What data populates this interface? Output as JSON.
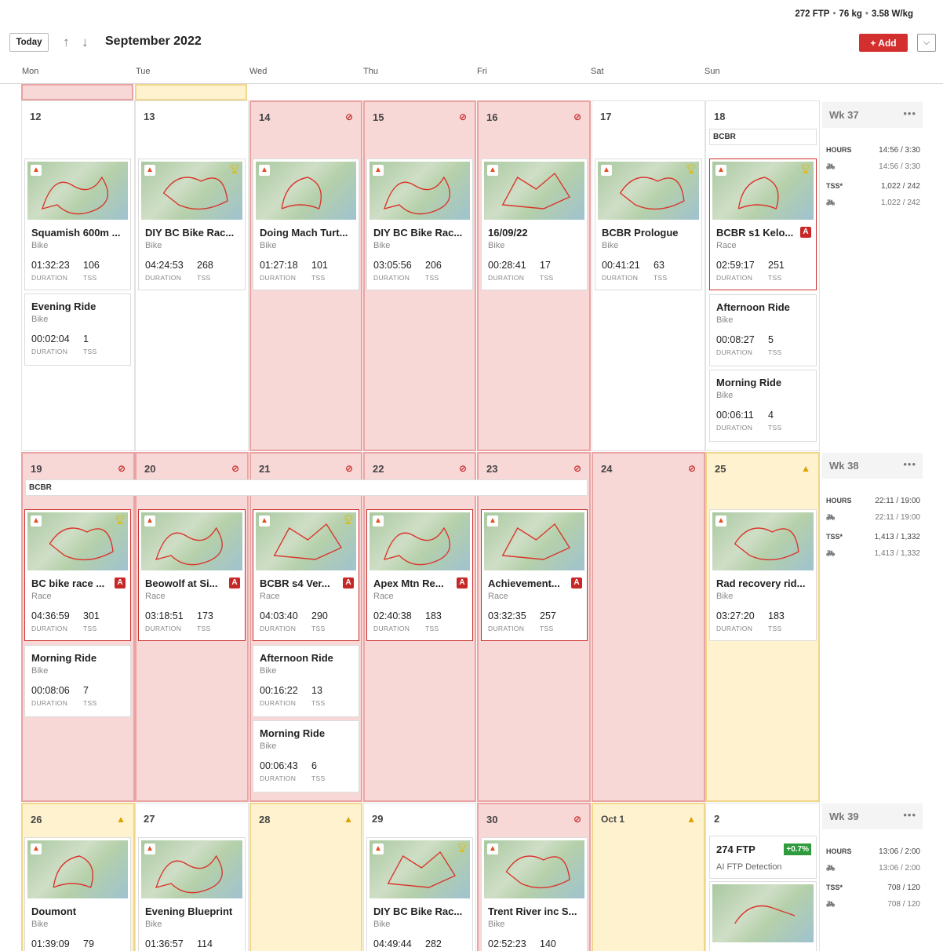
{
  "header": {
    "ftp": "272 FTP",
    "weight": "76 kg",
    "wkg": "3.58 W/kg",
    "today": "Today",
    "month": "September 2022",
    "add": "+ Add"
  },
  "days": [
    "Mon",
    "Tue",
    "Wed",
    "Thu",
    "Fri",
    "Sat",
    "Sun"
  ],
  "week37": {
    "wk": "Wk 37",
    "hours_label": "HOURS",
    "hours": "14:56 / 3:30",
    "hours_bike": "14:56 / 3:30",
    "tss_label": "TSS*",
    "tss": "1,022 / 242",
    "tss_bike": "1,022 / 242"
  },
  "week38": {
    "wk": "Wk 38",
    "hours_label": "HOURS",
    "hours": "22:11 / 19:00",
    "hours_bike": "22:11 / 19:00",
    "tss_label": "TSS*",
    "tss": "1,413 / 1,332",
    "tss_bike": "1,413 / 1,332"
  },
  "week39": {
    "wk": "Wk 39",
    "hours_label": "HOURS",
    "hours": "13:06 / 2:00",
    "hours_bike": "13:06 / 2:00",
    "tss_label": "TSS*",
    "tss": "708 / 120",
    "tss_bike": "708 / 120"
  },
  "labels": {
    "duration": "DURATION",
    "tss": "TSS",
    "race": "Race",
    "bike": "Bike",
    "bcbr": "BCBR",
    "a": "A"
  },
  "ftp_card": {
    "value": "274 FTP",
    "delta": "+0.7%",
    "sub": "AI FTP Detection"
  },
  "daynums": {
    "d12": "12",
    "d13": "13",
    "d14": "14",
    "d15": "15",
    "d16": "16",
    "d17": "17",
    "d18": "18",
    "d19": "19",
    "d20": "20",
    "d21": "21",
    "d22": "22",
    "d23": "23",
    "d24": "24",
    "d25": "25",
    "d26": "26",
    "d27": "27",
    "d28": "28",
    "d29": "29",
    "d30": "30",
    "oct1": "Oct 1",
    "d2": "2"
  },
  "activities": {
    "a12a": {
      "title": "Squamish 600m ...",
      "type": "Bike",
      "dur": "01:32:23",
      "tss": "106"
    },
    "a12b": {
      "title": "Evening Ride",
      "type": "Bike",
      "dur": "00:02:04",
      "tss": "1"
    },
    "a13a": {
      "title": "DIY BC Bike Rac...",
      "type": "Bike",
      "dur": "04:24:53",
      "tss": "268"
    },
    "a14a": {
      "title": "Doing Mach Turt...",
      "type": "Bike",
      "dur": "01:27:18",
      "tss": "101"
    },
    "a15a": {
      "title": "DIY BC Bike Rac...",
      "type": "Bike",
      "dur": "03:05:56",
      "tss": "206"
    },
    "a16a": {
      "title": "16/09/22",
      "type": "Bike",
      "dur": "00:28:41",
      "tss": "17"
    },
    "a17a": {
      "title": "BCBR Prologue",
      "type": "Bike",
      "dur": "00:41:21",
      "tss": "63"
    },
    "a18a": {
      "title": "BCBR s1 Kelo...",
      "type": "Race",
      "dur": "02:59:17",
      "tss": "251"
    },
    "a18b": {
      "title": "Afternoon Ride",
      "type": "Bike",
      "dur": "00:08:27",
      "tss": "5"
    },
    "a18c": {
      "title": "Morning Ride",
      "type": "Bike",
      "dur": "00:06:11",
      "tss": "4"
    },
    "a19a": {
      "title": "BC bike race ...",
      "type": "Race",
      "dur": "04:36:59",
      "tss": "301"
    },
    "a19b": {
      "title": "Morning Ride",
      "type": "Bike",
      "dur": "00:08:06",
      "tss": "7"
    },
    "a20a": {
      "title": "Beowolf at Si...",
      "type": "Race",
      "dur": "03:18:51",
      "tss": "173"
    },
    "a21a": {
      "title": "BCBR s4 Ver...",
      "type": "Race",
      "dur": "04:03:40",
      "tss": "290"
    },
    "a21b": {
      "title": "Afternoon Ride",
      "type": "Bike",
      "dur": "00:16:22",
      "tss": "13"
    },
    "a21c": {
      "title": "Morning Ride",
      "type": "Bike",
      "dur": "00:06:43",
      "tss": "6"
    },
    "a22a": {
      "title": "Apex Mtn Re...",
      "type": "Race",
      "dur": "02:40:38",
      "tss": "183"
    },
    "a23a": {
      "title": "Achievement...",
      "type": "Race",
      "dur": "03:32:35",
      "tss": "257"
    },
    "a25a": {
      "title": "Rad recovery rid...",
      "type": "Bike",
      "dur": "03:27:20",
      "tss": "183"
    },
    "a26a": {
      "title": "Doumont",
      "type": "Bike",
      "dur": "01:39:09",
      "tss": "79"
    },
    "a27a": {
      "title": "Evening Blueprint",
      "type": "Bike",
      "dur": "01:36:57",
      "tss": "114"
    },
    "a29a": {
      "title": "DIY BC Bike Rac...",
      "type": "Bike",
      "dur": "04:49:44",
      "tss": "282"
    },
    "a30a": {
      "title": "Trent River inc S...",
      "type": "Bike",
      "dur": "02:52:23",
      "tss": "140"
    }
  }
}
